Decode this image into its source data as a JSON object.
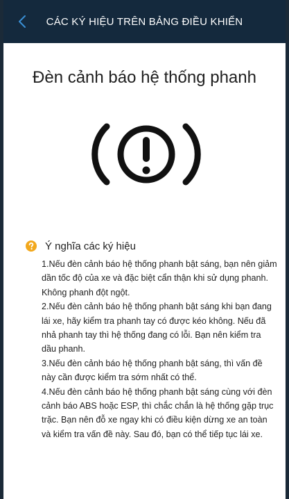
{
  "header": {
    "title": "CÁC KÝ HIỆU TRÊN BẢNG ĐIỀU KHIỂN",
    "back_icon": "chevron-left-icon"
  },
  "page": {
    "title": "Đèn cảnh báo hệ thống phanh",
    "symbol_icon": "brake-warning-icon"
  },
  "meaning": {
    "icon": "help-icon",
    "title": "Ý nghĩa các ký hiệu",
    "items": [
      "1.Nếu đèn cảnh báo hệ thống phanh bật sáng, bạn nên giảm dần tốc độ của xe và đặc biệt cẩn thận khi sử dụng phanh. Không phanh đột ngột.",
      "2.Nếu đèn cảnh báo hệ thống phanh bật sáng khi bạn đang lái xe, hãy kiểm tra phanh tay có được kéo không. Nếu đã nhả phanh tay thì hệ thống đang có lỗi. Bạn nên kiểm tra dầu phanh.",
      "3.Nếu đèn cảnh báo hệ thống phanh bật sáng, thì vấn đề này cần được kiểm tra sớm nhất có thể.",
      "4.Nếu đèn cảnh báo hệ thống phanh bật sáng cùng với đèn cảnh báo ABS hoặc ESP, thì chắc chắn là hệ thống gặp trục trặc. Bạn nên đỗ xe ngay khi có điều kiện dừng xe an toàn và kiểm tra vấn đề này. Sau đó, bạn có thể tiếp tục lái xe."
    ]
  },
  "colors": {
    "header_bg": "#14293d",
    "accent_blue": "#3a8fd6",
    "help_orange": "#f2a81d"
  }
}
